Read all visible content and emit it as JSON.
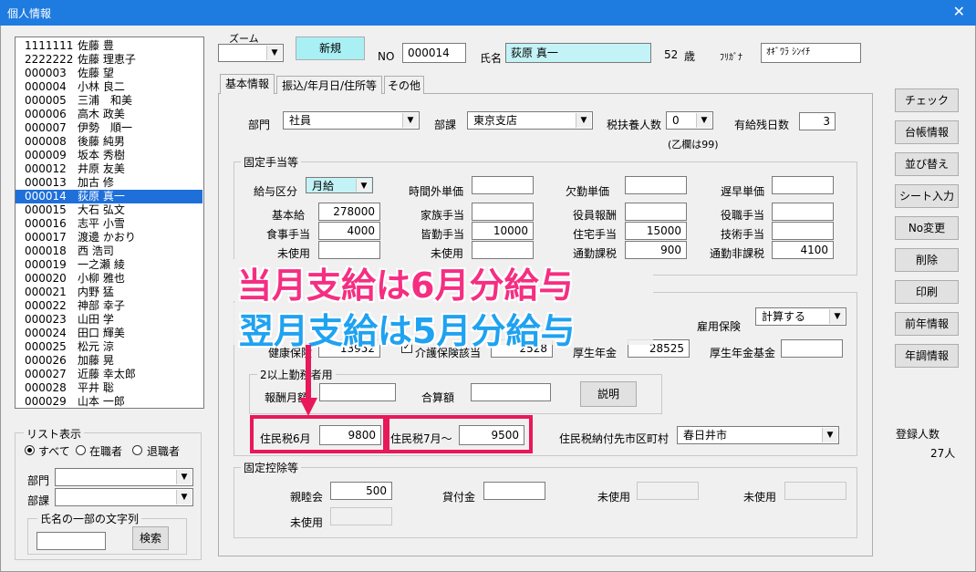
{
  "window": {
    "title": "個人情報",
    "close": "✕"
  },
  "employees": [
    {
      "code": "1111111",
      "name": "佐藤 豊"
    },
    {
      "code": "2222222",
      "name": "佐藤 理恵子"
    },
    {
      "code": "000003",
      "name": "佐藤 望"
    },
    {
      "code": "000004",
      "name": "小林 良二"
    },
    {
      "code": "000005",
      "name": "三浦　和美"
    },
    {
      "code": "000006",
      "name": "高木 政美"
    },
    {
      "code": "000007",
      "name": "伊勢　順一"
    },
    {
      "code": "000008",
      "name": "後藤 純男"
    },
    {
      "code": "000009",
      "name": "坂本 秀樹"
    },
    {
      "code": "000012",
      "name": "井原 友美"
    },
    {
      "code": "000013",
      "name": "加古 修"
    },
    {
      "code": "000014",
      "name": "荻原 真一"
    },
    {
      "code": "000015",
      "name": "大石 弘文"
    },
    {
      "code": "000016",
      "name": "志平 小雪"
    },
    {
      "code": "000017",
      "name": "渡邊 かおり"
    },
    {
      "code": "000018",
      "name": "西 浩司"
    },
    {
      "code": "000019",
      "name": "一之瀬 綾"
    },
    {
      "code": "000020",
      "name": "小柳 雅也"
    },
    {
      "code": "000021",
      "name": "内野 猛"
    },
    {
      "code": "000022",
      "name": "神部 幸子"
    },
    {
      "code": "000023",
      "name": "山田 学"
    },
    {
      "code": "000024",
      "name": "田口 輝美"
    },
    {
      "code": "000025",
      "name": "松元 涼"
    },
    {
      "code": "000026",
      "name": "加藤 晃"
    },
    {
      "code": "000027",
      "name": "近藤 幸太郎"
    },
    {
      "code": "000028",
      "name": "平井 聡"
    },
    {
      "code": "000029",
      "name": "山本 一郎"
    }
  ],
  "selected_index": 11,
  "list_display": {
    "title": "リスト表示",
    "radio_all": "すべて",
    "radio_active": "在職者",
    "radio_retired": "退職者",
    "dept_label": "部門",
    "section_label": "部課",
    "name_search_title": "氏名の一部の文字列",
    "search_button": "検索"
  },
  "header": {
    "zoom_label": "ズーム",
    "new_button": "新規",
    "no_label": "NO",
    "no_value": "000014",
    "name_label": "氏名",
    "name_value": "荻原 真一",
    "age_value": "52",
    "age_unit": "歳",
    "kana_label": "ﾌﾘｶﾞﾅ",
    "kana_value": "ｵｷﾞﾜﾗ ｼﾝｲﾁ"
  },
  "tabs": [
    "基本情報",
    "振込/年月日/住所等",
    "その他"
  ],
  "basic": {
    "dept_label": "部門",
    "dept_value": "社員",
    "section_label": "部課",
    "section_value": "東京支店",
    "dependents_label": "税扶養人数",
    "dependents_value": "0",
    "dependents_note": "(乙欄は99)",
    "paid_leave_label": "有給残日数",
    "paid_leave_value": "3"
  },
  "fixed_allowance": {
    "title": "固定手当等",
    "pay_type_label": "給与区分",
    "pay_type_value": "月給",
    "overtime_label": "時間外単価",
    "absence_label": "欠勤単価",
    "late_label": "遅早単価",
    "base_label": "基本給",
    "base_value": "278000",
    "family_label": "家族手当",
    "officer_label": "役員報酬",
    "position_label": "役職手当",
    "meal_label": "食事手当",
    "meal_value": "4000",
    "attendance_label": "皆勤手当",
    "attendance_value": "10000",
    "housing_label": "住宅手当",
    "housing_value": "15000",
    "skill_label": "技術手当",
    "unused1_label": "未使用",
    "unused2_label": "未使用",
    "taxable_commute_label": "通勤課税",
    "taxable_commute_value": "900",
    "nontax_commute_label": "通勤非課税",
    "nontax_commute_value": "4100"
  },
  "insurance": {
    "emp_ins_label": "雇用保険",
    "emp_ins_value": "計算する",
    "health_label": "健康保険",
    "health_value": "13952",
    "care_label": "介護保険該当",
    "care_value": "2528",
    "pension_label": "厚生年金",
    "pension_value": "28525",
    "fund_label": "厚生年金基金",
    "multi_title": "2以上勤務者用",
    "monthly_label": "報酬月額",
    "total_label": "合算額",
    "explain_button": "説明"
  },
  "resident_tax": {
    "june_label": "住民税6月",
    "june_value": "9800",
    "july_label": "住民税7月～",
    "july_value": "9500",
    "city_label": "住民税納付先市区町村",
    "city_value": "春日井市"
  },
  "fixed_deduction": {
    "title": "固定控除等",
    "social_label": "親睦会",
    "social_value": "500",
    "loan_label": "貸付金",
    "unused1_label": "未使用",
    "unused2_label": "未使用",
    "unused3_label": "未使用"
  },
  "side_buttons": [
    "チェック",
    "台帳情報",
    "並び替え",
    "シート入力",
    "No変更",
    "削除",
    "印刷",
    "前年情報",
    "年調情報"
  ],
  "registered": {
    "label": "登録人数",
    "value": "27人"
  },
  "overlay": {
    "line1": "当月支給は6月分給与",
    "line2": "翌月支給は5月分給与"
  },
  "colors": {
    "title_bar": "#1e7be0",
    "selection": "#1e6fd9",
    "new_button": "#a9f0f5",
    "name_field": "#c4f3f7",
    "overlay_pink": "#f52e82",
    "overlay_blue": "#1fa2f0",
    "highlight_border": "#e8185a"
  }
}
